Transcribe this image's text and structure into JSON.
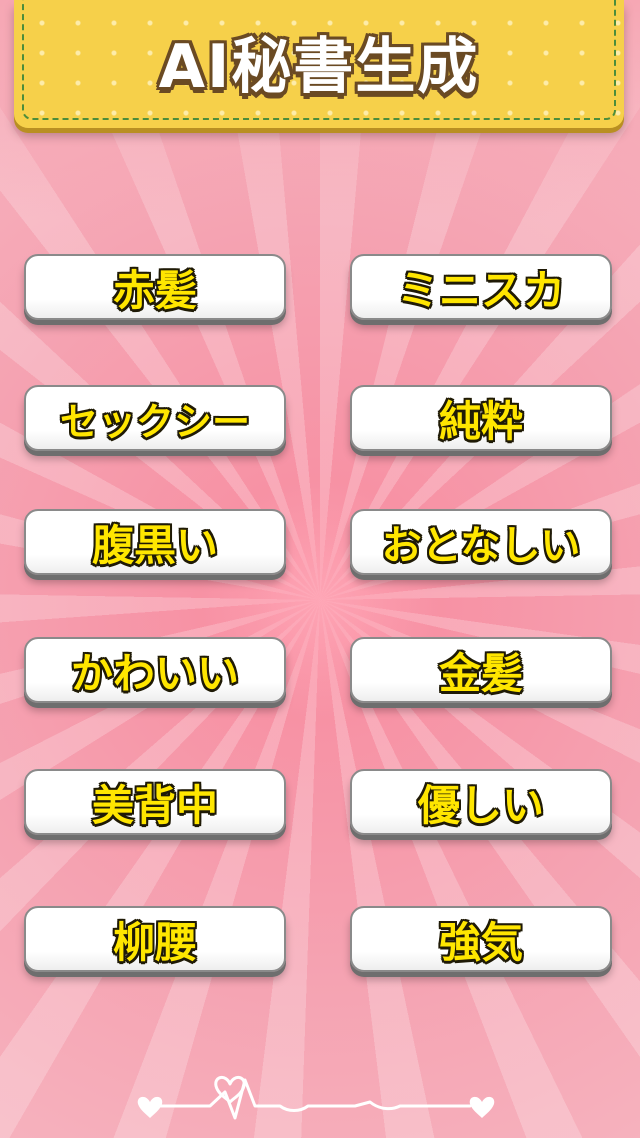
{
  "title": "AI秘書生成",
  "options": [
    {
      "label": "赤髪"
    },
    {
      "label": "ミニスカ"
    },
    {
      "label": "セックシー"
    },
    {
      "label": "純粋"
    },
    {
      "label": "腹黒い"
    },
    {
      "label": "おとなしい"
    },
    {
      "label": "かわいい"
    },
    {
      "label": "金髪"
    },
    {
      "label": "美背中"
    },
    {
      "label": "優しい"
    },
    {
      "label": "柳腰"
    },
    {
      "label": "強気"
    }
  ],
  "colors": {
    "banner": "#f6d04a",
    "button_text": "#ffe600",
    "background": "#f7a3b0"
  },
  "icons": [
    "heart-line-icon"
  ]
}
